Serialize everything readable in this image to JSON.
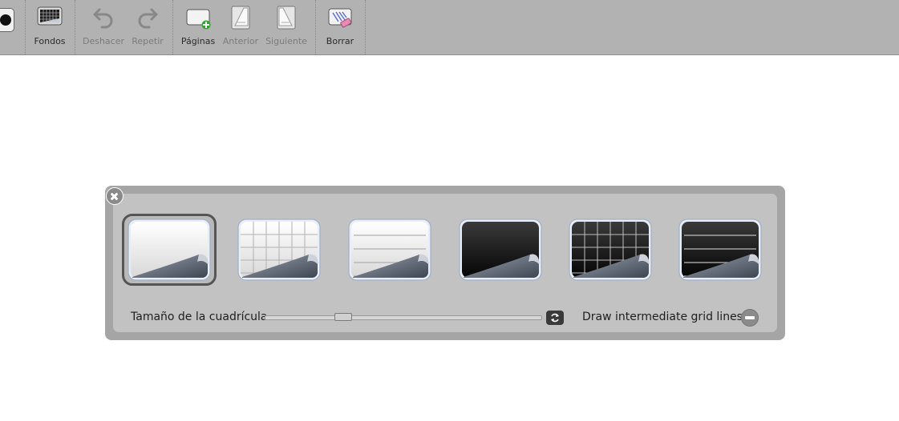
{
  "toolbar": {
    "fondos": "Fondos",
    "deshacer": "Deshacer",
    "repetir": "Repetir",
    "paginas": "Páginas",
    "anterior": "Anterior",
    "siguiente": "Siguiente",
    "borrar": "Borrar"
  },
  "panel": {
    "backgrounds": [
      {
        "name": "plain-white",
        "dark": false,
        "pattern": "plain",
        "selected": true
      },
      {
        "name": "grid-white",
        "dark": false,
        "pattern": "grid",
        "selected": false
      },
      {
        "name": "ruled-white",
        "dark": false,
        "pattern": "ruled",
        "selected": false
      },
      {
        "name": "plain-black",
        "dark": true,
        "pattern": "plain",
        "selected": false
      },
      {
        "name": "grid-black",
        "dark": true,
        "pattern": "grid",
        "selected": false
      },
      {
        "name": "ruled-black",
        "dark": true,
        "pattern": "ruled",
        "selected": false
      }
    ],
    "grid_size_label": "Tamaño de la cuadrícula",
    "grid_size_value": 0.27,
    "intermediate_label": "Draw intermediate grid lines"
  },
  "colors": {
    "toolbar_bg": "#b2b2b2",
    "panel_bg": "#a5a5a5",
    "panel_inner_bg": "#c2c2c2"
  }
}
